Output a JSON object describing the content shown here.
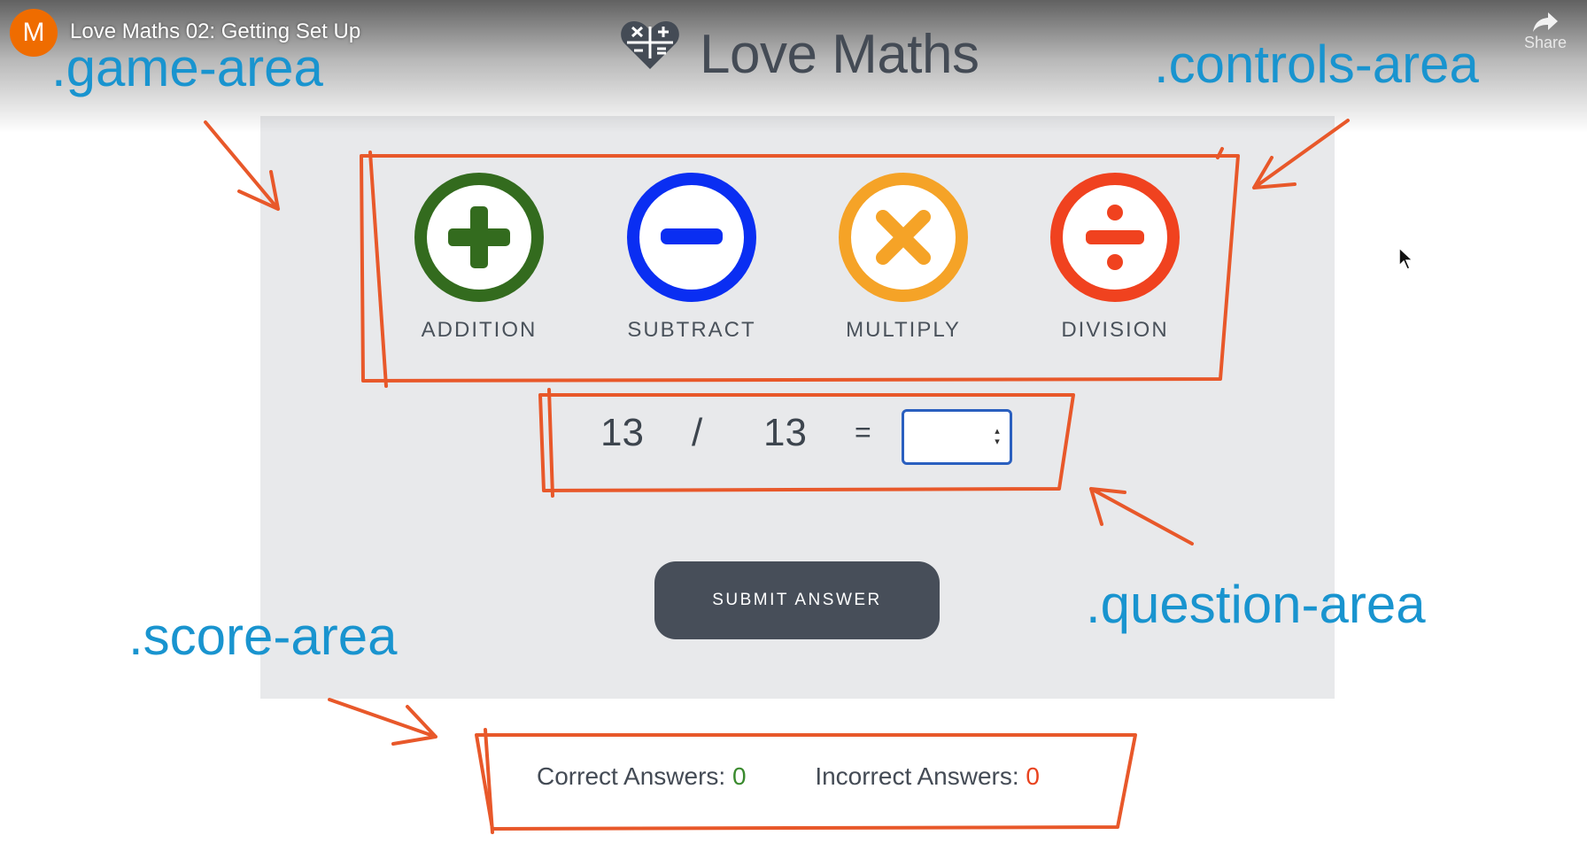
{
  "video": {
    "channel_initial": "M",
    "title": "Love Maths 02: Getting Set Up",
    "share_label": "Share"
  },
  "brand": {
    "title": "Love Maths",
    "logo_icon": "heart-math-icon"
  },
  "operations": [
    {
      "label": "ADDITION",
      "icon": "plus-icon",
      "color": "#336b1e"
    },
    {
      "label": "SUBTRACT",
      "icon": "minus-icon",
      "color": "#0a2ef2"
    },
    {
      "label": "MULTIPLY",
      "icon": "times-icon",
      "color": "#f5a327"
    },
    {
      "label": "DIVISION",
      "icon": "divide-icon",
      "color": "#f0421f"
    }
  ],
  "question": {
    "operand1": "13",
    "operator": "/",
    "operand2": "13",
    "equals": "=",
    "answer_value": ""
  },
  "submit_label": "SUBMIT ANSWER",
  "score": {
    "correct_label": "Correct Answers:",
    "correct_value": "0",
    "incorrect_label": "Incorrect Answers:",
    "incorrect_value": "0"
  },
  "annotations": {
    "game_area": ".game-area",
    "controls_area": ".controls-area",
    "question_area": ".question-area",
    "score_area": ".score-area"
  },
  "colors": {
    "annotation_blue": "#1994cf",
    "sketch_orange": "#e8582a",
    "game_bg": "#e8e9eb",
    "button_dark": "#474e59"
  }
}
